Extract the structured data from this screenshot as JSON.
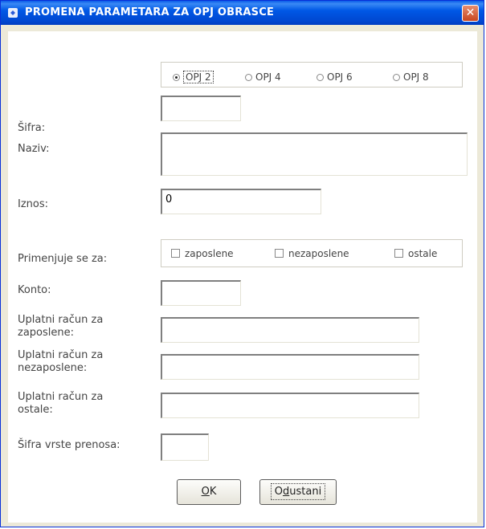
{
  "window": {
    "title": "PROMENA PARAMETARA ZA OPJ OBRASCE",
    "close_glyph": "✕"
  },
  "opj_options": [
    {
      "label": "OPJ 2",
      "selected": true
    },
    {
      "label": "OPJ 4",
      "selected": false
    },
    {
      "label": "OPJ 6",
      "selected": false
    },
    {
      "label": "OPJ 8",
      "selected": false
    }
  ],
  "fields": {
    "sifra": {
      "label": "Šifra:",
      "value": ""
    },
    "naziv": {
      "label": "Naziv:",
      "value": ""
    },
    "iznos": {
      "label": "Iznos:",
      "value": "0"
    },
    "konto": {
      "label": "Konto:",
      "value": ""
    },
    "racun_zaposlene": {
      "label": "Uplatni račun za zaposlene:",
      "value": ""
    },
    "racun_nezaposlene": {
      "label": "Uplatni račun za nezaposlene:",
      "value": ""
    },
    "racun_ostale": {
      "label": "Uplatni račun za ostale:",
      "value": ""
    },
    "sifra_vrste_prenosa": {
      "label": "Šifra vrste prenosa:",
      "value": ""
    }
  },
  "primenjuje": {
    "label": "Primenjuje se za:",
    "options": [
      {
        "label": "zaposlene",
        "checked": false
      },
      {
        "label": "nezaposlene",
        "checked": false
      },
      {
        "label": "ostale",
        "checked": false
      }
    ]
  },
  "buttons": {
    "ok_accel": "O",
    "ok_rest": "K",
    "cancel_pre": "O",
    "cancel_accel": "d",
    "cancel_rest": "ustani"
  },
  "colors": {
    "titlebar": "#0054e3",
    "window_bg": "#ece9d8",
    "close_button": "#d6582f"
  }
}
